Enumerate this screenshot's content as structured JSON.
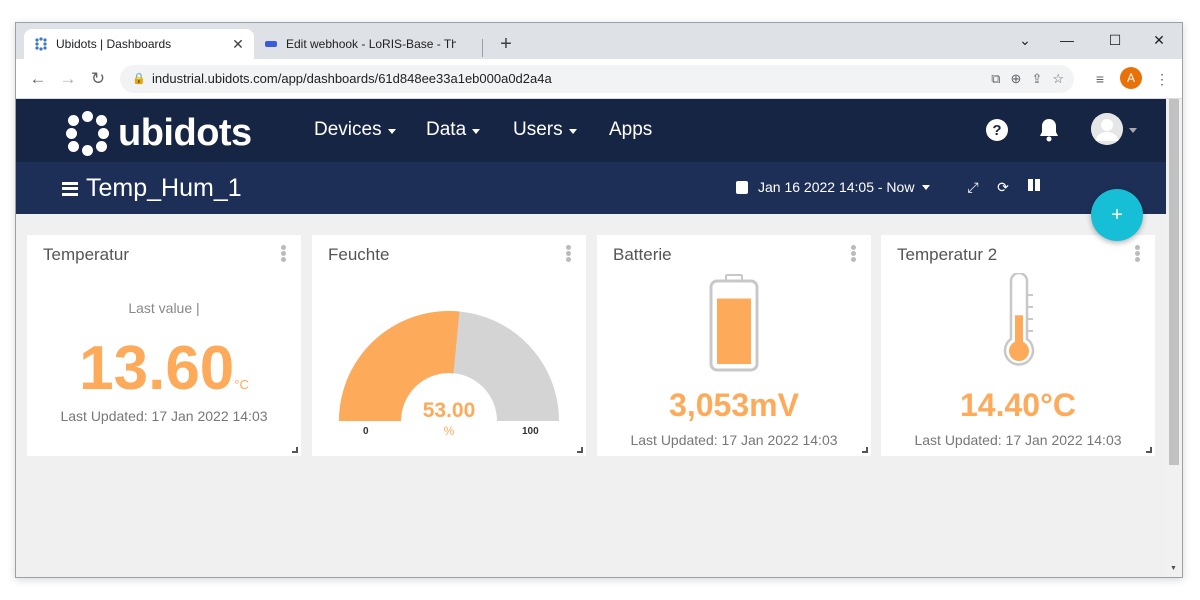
{
  "browser": {
    "tabs": [
      {
        "title": "Ubidots | Dashboards",
        "active": true
      },
      {
        "title": "Edit webhook - LoRIS-Base - The",
        "active": false
      }
    ],
    "url": "industrial.ubidots.com/app/dashboards/61d848ee33a1eb000a0d2a4a",
    "profile_initial": "A"
  },
  "app": {
    "logo_text": "ubidots",
    "nav": [
      {
        "label": "Devices"
      },
      {
        "label": "Data"
      },
      {
        "label": "Users"
      },
      {
        "label": "Apps"
      }
    ]
  },
  "dashboard": {
    "title": "Temp_Hum_1",
    "date_range": "Jan 16 2022 14:05 - Now",
    "add_label": "+"
  },
  "widgets": {
    "temperatur": {
      "title": "Temperatur",
      "subtitle": "Last value |",
      "value": "13.60",
      "unit": "°C",
      "updated": "Last Updated: 17 Jan 2022 14:03"
    },
    "feuchte": {
      "title": "Feuchte",
      "value": "53.00",
      "unit": "%",
      "min": "0",
      "max": "100",
      "fraction": 0.53
    },
    "batterie": {
      "title": "Batterie",
      "value": "3,053mV",
      "updated": "Last Updated: 17 Jan 2022 14:03",
      "fill_level": 0.85
    },
    "temperatur2": {
      "title": "Temperatur 2",
      "value": "14.40°C",
      "updated": "Last Updated: 17 Jan 2022 14:03",
      "fill_level": 0.45
    }
  },
  "colors": {
    "accent_orange": "#fdaa5b",
    "header_navy": "#172545",
    "dashbar_navy": "#1e2f57",
    "fab_cyan": "#17bfd6",
    "gauge_grey": "#d4d4d4"
  }
}
